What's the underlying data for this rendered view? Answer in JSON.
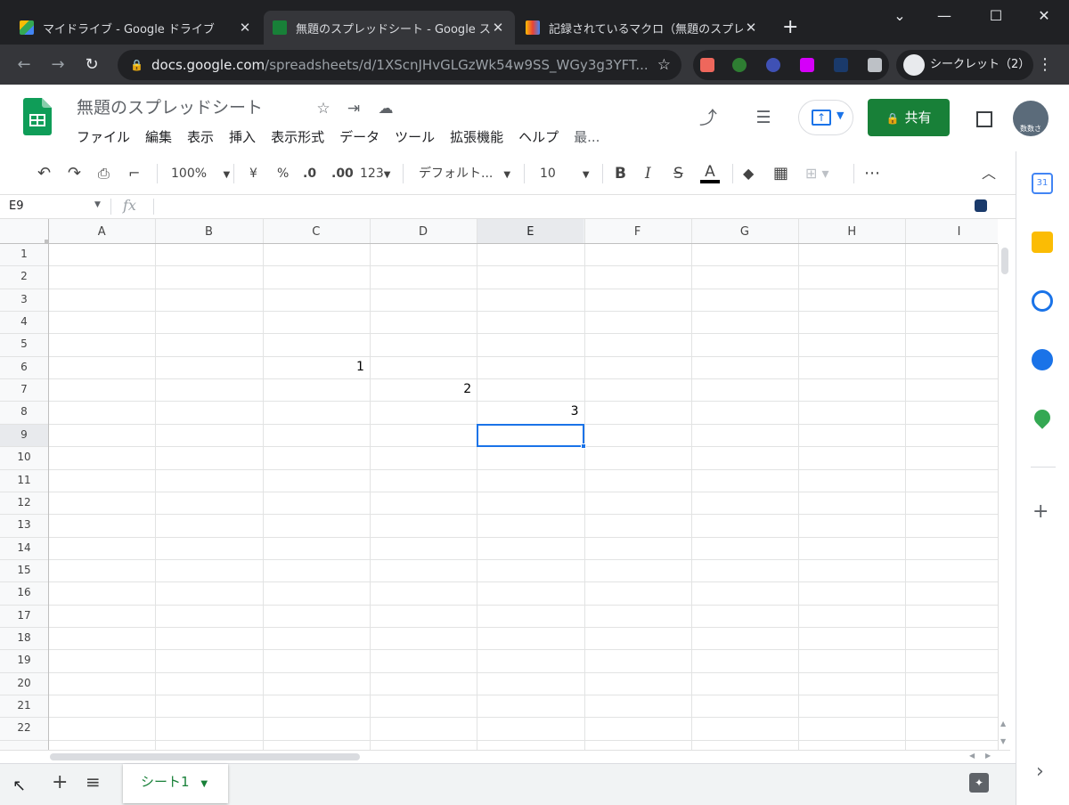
{
  "browser": {
    "tabs": [
      {
        "title": "マイドライブ - Google ドライブ",
        "close": "✕"
      },
      {
        "title": "無題のスプレッドシート - Google スプ",
        "close": "✕"
      },
      {
        "title": "記録されているマクロ（無題のスプレッ",
        "close": "✕"
      }
    ],
    "new_tab": "+",
    "url_host": "docs.google.com",
    "url_path": "/spreadsheets/d/1XScnJHvGLGzWk54w9SS_WGy3g3YFT...",
    "incognito_label": "シークレット（2）"
  },
  "doc": {
    "title": "無題のスプレッドシート",
    "menus": [
      "ファイル",
      "編集",
      "表示",
      "挿入",
      "表示形式",
      "データ",
      "ツール",
      "拡張機能",
      "ヘルプ",
      "最..."
    ],
    "share_label": "共有",
    "avatar_text": "数数さ"
  },
  "toolbar": {
    "zoom": "100%",
    "currency": "¥",
    "percent": "%",
    "dec_decrease": ".0",
    "dec_increase": ".00",
    "number_format": "123",
    "font": "デフォルト...",
    "font_size": "10",
    "bold": "B",
    "italic": "I",
    "strike": "S",
    "text_color": "A",
    "more": "⋯"
  },
  "formula_bar": {
    "name_box": "E9",
    "fx": "fx",
    "value": ""
  },
  "grid": {
    "columns": [
      "A",
      "B",
      "C",
      "D",
      "E",
      "F",
      "G",
      "H",
      "I"
    ],
    "rows": [
      "1",
      "2",
      "3",
      "4",
      "5",
      "6",
      "7",
      "8",
      "9",
      "10",
      "11",
      "12",
      "13",
      "14",
      "15",
      "16",
      "17",
      "18",
      "19",
      "20",
      "21",
      "22"
    ],
    "selected_cell": "E9",
    "cells": [
      {
        "ref": "C6",
        "value": "1"
      },
      {
        "ref": "D7",
        "value": "2"
      },
      {
        "ref": "E8",
        "value": "3"
      }
    ]
  },
  "sheets": {
    "add": "+",
    "list": "≡",
    "tabs": [
      {
        "name": "シート1"
      }
    ]
  },
  "side_panel": {
    "calendar_day": "31",
    "add": "+",
    "expand": "›"
  },
  "colors": {
    "sheets_green": "#188038",
    "selection_blue": "#1a73e8",
    "chrome_dark": "#202124"
  }
}
